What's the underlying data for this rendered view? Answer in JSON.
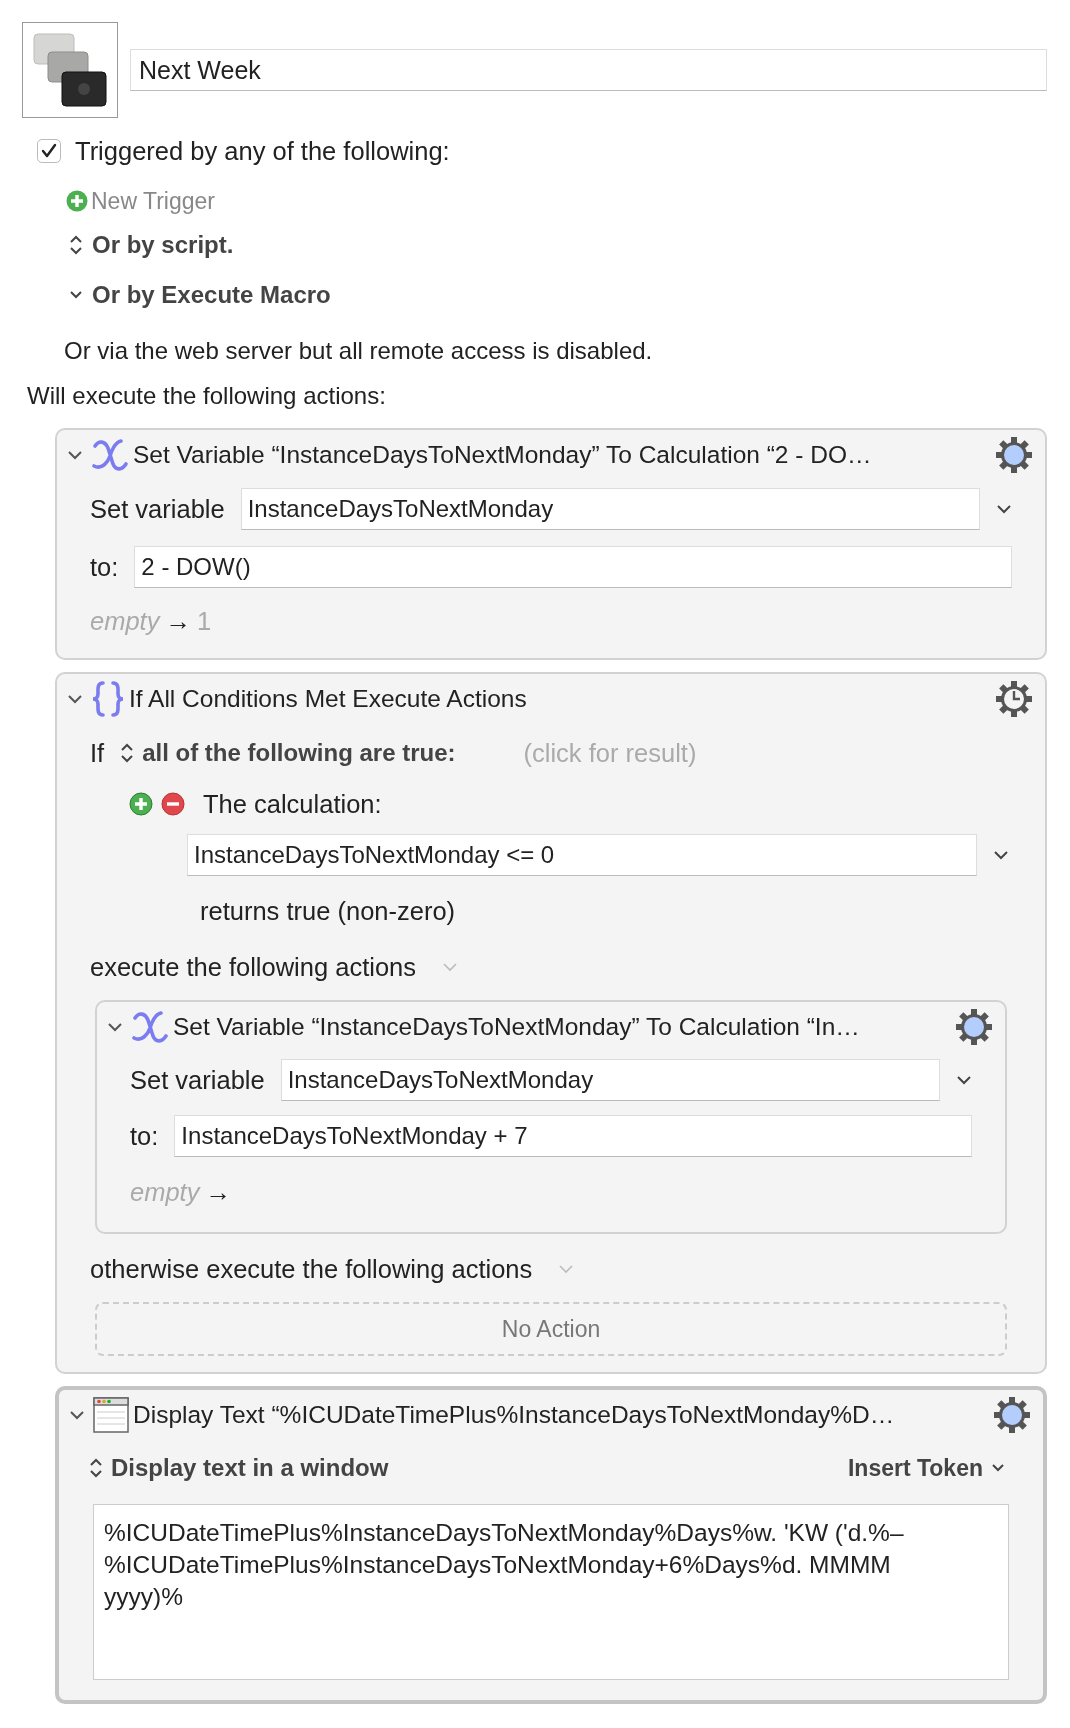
{
  "macro": {
    "name": "Next Week"
  },
  "trigger": {
    "label": "Triggered by any of the following:",
    "checked": true
  },
  "new_trigger": "New Trigger",
  "options": [
    {
      "label": "Or by script.",
      "expanded": false
    },
    {
      "label": "Or by Execute Macro",
      "expanded": true
    }
  ],
  "web_server_note": "Or via the web server but all remote access is disabled.",
  "actions_heading": "Will execute the following actions:",
  "actions": [
    {
      "kind": "set_variable",
      "expanded": true,
      "selected": false,
      "title": "Set Variable “InstanceDaysToNextMonday” To Calculation “2 - DO…",
      "set_label": "Set variable",
      "variable": "InstanceDaysToNextMonday",
      "to_label": "to:",
      "value": "2 - DOW()",
      "empty_label": "empty",
      "arrow": "→",
      "result": "1"
    },
    {
      "kind": "if",
      "expanded": true,
      "selected": false,
      "title": "If All Conditions Met Execute Actions",
      "if_label": "If",
      "condition_mode": "all of the following are true:",
      "click_hint": "(click for result)",
      "condition_label": "The calculation:",
      "calculation": "InstanceDaysToNextMonday <= 0",
      "returns": "returns true (non-zero)",
      "then_label": "execute the following actions",
      "then_actions": [
        {
          "kind": "set_variable",
          "expanded": true,
          "title": "Set Variable “InstanceDaysToNextMonday” To Calculation “In…",
          "set_label": "Set variable",
          "variable": "InstanceDaysToNextMonday",
          "to_label": "to:",
          "value": "InstanceDaysToNextMonday + 7",
          "empty_label": "empty",
          "arrow": "→"
        }
      ],
      "else_label": "otherwise execute the following actions",
      "else_empty": "No Action"
    },
    {
      "kind": "display_text",
      "expanded": true,
      "selected": true,
      "title": "Display Text “%ICUDateTimePlus%InstanceDaysToNextMonday%D…",
      "mode": "Display text in a window",
      "insert_token": "Insert Token",
      "text_lines": [
        "%ICUDateTimePlus%InstanceDaysToNextMonday%Days%w. 'KW ('d.%–",
        "%ICUDateTimePlus%InstanceDaysToNextMonday+6%Days%d. MMMM",
        "yyyy)%"
      ]
    }
  ]
}
